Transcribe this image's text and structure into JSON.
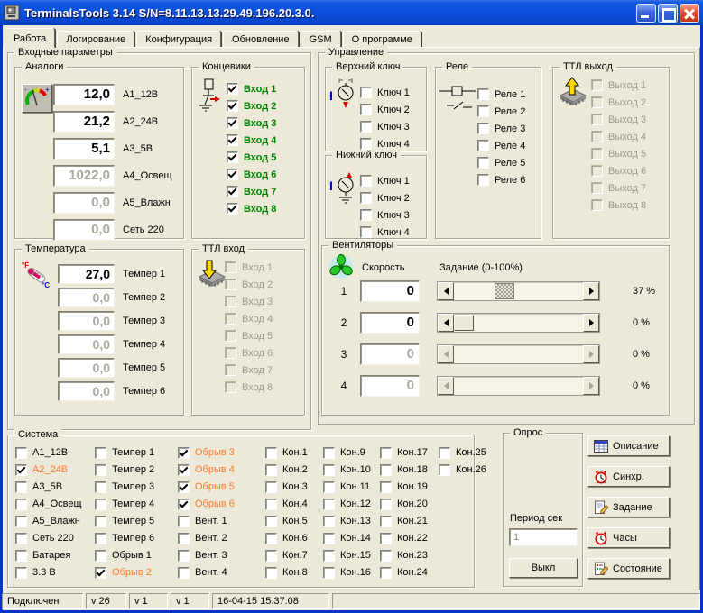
{
  "window": {
    "title": "TerminalsTools 3.14  S/N=8.11.13.13.29.49.196.20.3.0."
  },
  "tabs": [
    {
      "label": "Работа",
      "active": true
    },
    {
      "label": "Логирование"
    },
    {
      "label": "Конфигурация"
    },
    {
      "label": "Обновление"
    },
    {
      "label": "GSM"
    },
    {
      "label": "О программе"
    }
  ],
  "inputs": {
    "title": "Входные параметры",
    "analogs": {
      "title": "Аналоги",
      "rows": [
        {
          "value": "12,0",
          "label": "А1_12В"
        },
        {
          "value": "21,2",
          "label": "А2_24В"
        },
        {
          "value": "5,1",
          "label": "А3_5В"
        },
        {
          "value": "1022,0",
          "label": "А4_Освещ",
          "disabled": true
        },
        {
          "value": "0,0",
          "label": "А5_Влажн",
          "disabled": true
        },
        {
          "value": "0,0",
          "label": "Сеть 220",
          "disabled": true
        }
      ]
    },
    "limit_switches": {
      "title": "Концевики",
      "items": [
        {
          "label": "Вход 1",
          "checked": true
        },
        {
          "label": "Вход 2",
          "checked": true
        },
        {
          "label": "Вход 3",
          "checked": true
        },
        {
          "label": "Вход 4",
          "checked": true
        },
        {
          "label": "Вход 5",
          "checked": true
        },
        {
          "label": "Вход 6",
          "checked": true
        },
        {
          "label": "Вход 7",
          "checked": true
        },
        {
          "label": "Вход 8",
          "checked": true
        }
      ]
    },
    "temperature": {
      "title": "Температура",
      "rows": [
        {
          "value": "27,0",
          "label": "Темпер 1"
        },
        {
          "value": "0,0",
          "label": "Темпер 2",
          "disabled": true
        },
        {
          "value": "0,0",
          "label": "Темпер 3",
          "disabled": true
        },
        {
          "value": "0,0",
          "label": "Темпер 4",
          "disabled": true
        },
        {
          "value": "0,0",
          "label": "Темпер 5",
          "disabled": true
        },
        {
          "value": "0,0",
          "label": "Темпер 6",
          "disabled": true
        }
      ]
    },
    "ttl_in": {
      "title": "ТТЛ вход",
      "items": [
        {
          "label": "Вход 1",
          "disabled": true
        },
        {
          "label": "Вход 2",
          "disabled": true
        },
        {
          "label": "Вход 3",
          "disabled": true
        },
        {
          "label": "Вход 4",
          "disabled": true
        },
        {
          "label": "Вход 5",
          "disabled": true
        },
        {
          "label": "Вход 6",
          "disabled": true
        },
        {
          "label": "Вход 7",
          "disabled": true
        },
        {
          "label": "Вход 8",
          "disabled": true
        }
      ]
    }
  },
  "control": {
    "title": "Управление",
    "upper_key": {
      "title": "Верхний ключ",
      "items": [
        {
          "label": "Ключ 1"
        },
        {
          "label": "Ключ 2"
        },
        {
          "label": "Ключ 3"
        },
        {
          "label": "Ключ 4"
        }
      ]
    },
    "lower_key": {
      "title": "Нижний ключ",
      "items": [
        {
          "label": "Ключ 1"
        },
        {
          "label": "Ключ 2"
        },
        {
          "label": "Ключ 3"
        },
        {
          "label": "Ключ 4"
        }
      ]
    },
    "relays": {
      "title": "Реле",
      "items": [
        {
          "label": "Реле 1"
        },
        {
          "label": "Реле 2"
        },
        {
          "label": "Реле 3"
        },
        {
          "label": "Реле 4"
        },
        {
          "label": "Реле 5"
        },
        {
          "label": "Реле 6"
        }
      ]
    },
    "ttl_out": {
      "title": "ТТЛ выход",
      "items": [
        {
          "label": "Выход 1",
          "disabled": true
        },
        {
          "label": "Выход 2",
          "disabled": true
        },
        {
          "label": "Выход 3",
          "disabled": true
        },
        {
          "label": "Выход 4",
          "disabled": true
        },
        {
          "label": "Выход 5",
          "disabled": true
        },
        {
          "label": "Выход 6",
          "disabled": true
        },
        {
          "label": "Выход 7",
          "disabled": true
        },
        {
          "label": "Выход 8",
          "disabled": true
        }
      ]
    },
    "fans": {
      "title": "Вентиляторы",
      "speed_header": "Скорость",
      "setpoint_header": "Задание (0-100%)",
      "rows": [
        {
          "num": "1",
          "value": "0",
          "percent": "37 %",
          "pos": 37,
          "dragging": true
        },
        {
          "num": "2",
          "value": "0",
          "percent": "0 %",
          "pos": 0
        },
        {
          "num": "3",
          "value": "0",
          "percent": "0 %",
          "pos": 0,
          "disabled": true
        },
        {
          "num": "4",
          "value": "0",
          "percent": "0 %",
          "pos": 0,
          "disabled": true
        }
      ]
    }
  },
  "system": {
    "title": "Система",
    "columns": [
      [
        {
          "label": "А1_12В"
        },
        {
          "label": "А2_24В",
          "checked": true,
          "alarm": true
        },
        {
          "label": "А3_5В"
        },
        {
          "label": "А4_Освещ"
        },
        {
          "label": "А5_Влажн"
        },
        {
          "label": "Сеть 220"
        },
        {
          "label": "Батарея"
        },
        {
          "label": "3.3 В"
        }
      ],
      [
        {
          "label": "Темпер 1"
        },
        {
          "label": "Темпер 2"
        },
        {
          "label": "Темпер 3"
        },
        {
          "label": "Темпер 4"
        },
        {
          "label": "Темпер 5"
        },
        {
          "label": "Темпер 6"
        },
        {
          "label": "Обрыв 1"
        },
        {
          "label": "Обрыв 2",
          "checked": true,
          "alarm": true
        }
      ],
      [
        {
          "label": "Обрыв 3",
          "checked": true,
          "alarm": true
        },
        {
          "label": "Обрыв 4",
          "checked": true,
          "alarm": true
        },
        {
          "label": "Обрыв 5",
          "checked": true,
          "alarm": true
        },
        {
          "label": "Обрыв 6",
          "checked": true,
          "alarm": true
        },
        {
          "label": "Вент. 1"
        },
        {
          "label": "Вент. 2"
        },
        {
          "label": "Вент. 3"
        },
        {
          "label": "Вент. 4"
        }
      ],
      [
        {
          "label": "Кон.1"
        },
        {
          "label": "Кон.2"
        },
        {
          "label": "Кон.3"
        },
        {
          "label": "Кон.4"
        },
        {
          "label": "Кон.5"
        },
        {
          "label": "Кон.6"
        },
        {
          "label": "Кон.7"
        },
        {
          "label": "Кон.8"
        }
      ],
      [
        {
          "label": "Кон.9"
        },
        {
          "label": "Кон.10"
        },
        {
          "label": "Кон.11"
        },
        {
          "label": "Кон.12"
        },
        {
          "label": "Кон.13"
        },
        {
          "label": "Кон.14"
        },
        {
          "label": "Кон.15"
        },
        {
          "label": "Кон.16"
        }
      ],
      [
        {
          "label": "Кон.17"
        },
        {
          "label": "Кон.18"
        },
        {
          "label": "Кон.19"
        },
        {
          "label": "Кон.20"
        },
        {
          "label": "Кон.21"
        },
        {
          "label": "Кон.22"
        },
        {
          "label": "Кон.23"
        },
        {
          "label": "Кон.24"
        }
      ],
      [
        {
          "label": "Кон.25"
        },
        {
          "label": "Кон.26"
        }
      ]
    ]
  },
  "poll": {
    "title": "Опрос",
    "period_label": "Период сек",
    "period_value": "1",
    "off_button": "Выкл"
  },
  "actions": [
    {
      "label": "Описание",
      "icon": "table-icon"
    },
    {
      "label": "Синхр.",
      "icon": "alarm-clock-icon"
    },
    {
      "label": "Задание",
      "icon": "task-edit-icon"
    },
    {
      "label": "Часы",
      "icon": "alarm-clock-icon"
    },
    {
      "label": "Состояние",
      "icon": "status-edit-icon"
    }
  ],
  "statusbar": {
    "panels": [
      "Подключен",
      "v 26",
      "v 1",
      "v 1",
      "16-04-15 15:37:08",
      ""
    ]
  },
  "colors": {
    "checked_input_label": "#008000",
    "alarm_label": "#FF7A30",
    "title_bar": "#0A4FDC",
    "window_border": "#0833C8"
  }
}
